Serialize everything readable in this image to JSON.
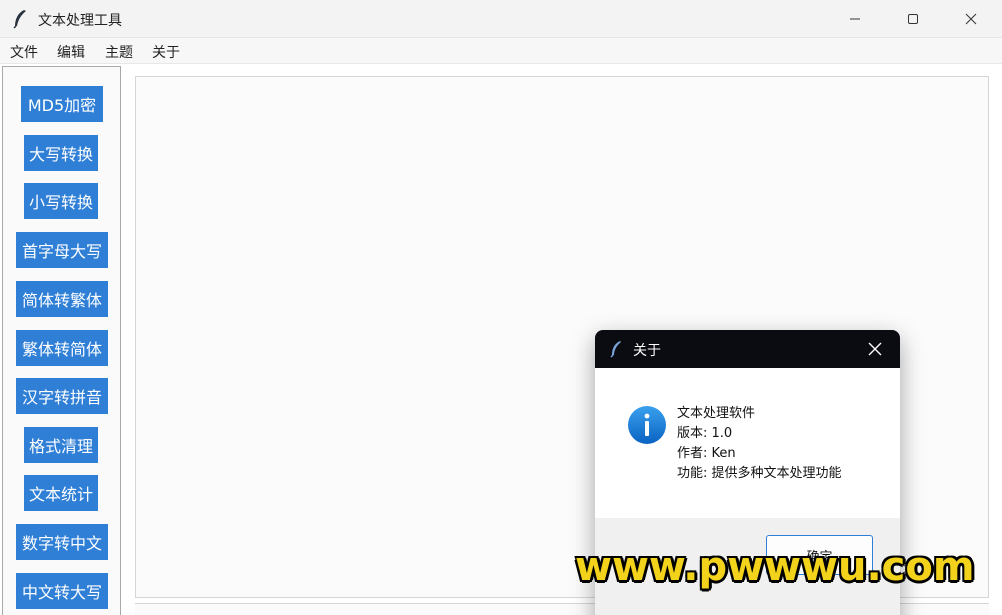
{
  "window": {
    "title": "文本处理工具"
  },
  "menubar": {
    "items": [
      "文件",
      "编辑",
      "主题",
      "关于"
    ]
  },
  "sidebar": {
    "buttons": [
      "MD5加密",
      "大写转换",
      "小写转换",
      "首字母大写",
      "简体转繁体",
      "繁体转简体",
      "汉字转拼音",
      "格式清理",
      "文本统计",
      "数字转中文",
      "中文转大写"
    ]
  },
  "editor": {
    "content": ""
  },
  "dialog": {
    "title": "关于",
    "lines": [
      "文本处理软件",
      "版本: 1.0",
      "作者: Ken",
      "功能: 提供多种文本处理功能"
    ],
    "ok_label": "确定"
  },
  "watermark": "www.pwwwu.com",
  "colors": {
    "accent": "#2f7fd6",
    "dialog_titlebar": "#0b0b12",
    "watermark": "#f2d21b"
  },
  "icons": {
    "app": "feather-icon",
    "info": "info-icon",
    "close": "close-icon"
  }
}
